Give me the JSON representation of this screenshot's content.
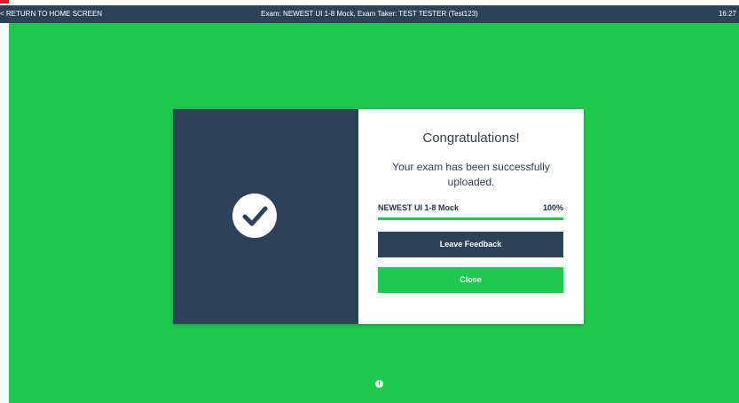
{
  "topbar": {
    "home_label": "< RETURN TO HOME SCREEN",
    "title": "Exam: NEWEST UI 1-8 Mock, Exam Taker: TEST TESTER (Test123)",
    "clock": "16:27"
  },
  "modal": {
    "icon": "checkmark-icon",
    "heading": "Congratulations!",
    "message": "Your exam has been successfully uploaded.",
    "exam_name": "NEWEST UI 1-8 Mock",
    "percent_text": "100%",
    "progress_fraction": 1.0,
    "feedback_label": "Leave Feedback",
    "close_label": "Close"
  },
  "footer": {
    "icon": "info-icon",
    "glyph": "i"
  },
  "colors": {
    "topbar": "#2d4257",
    "background": "#1ec94f",
    "panel": "#2d4257",
    "accent_red": "#e4161b"
  }
}
